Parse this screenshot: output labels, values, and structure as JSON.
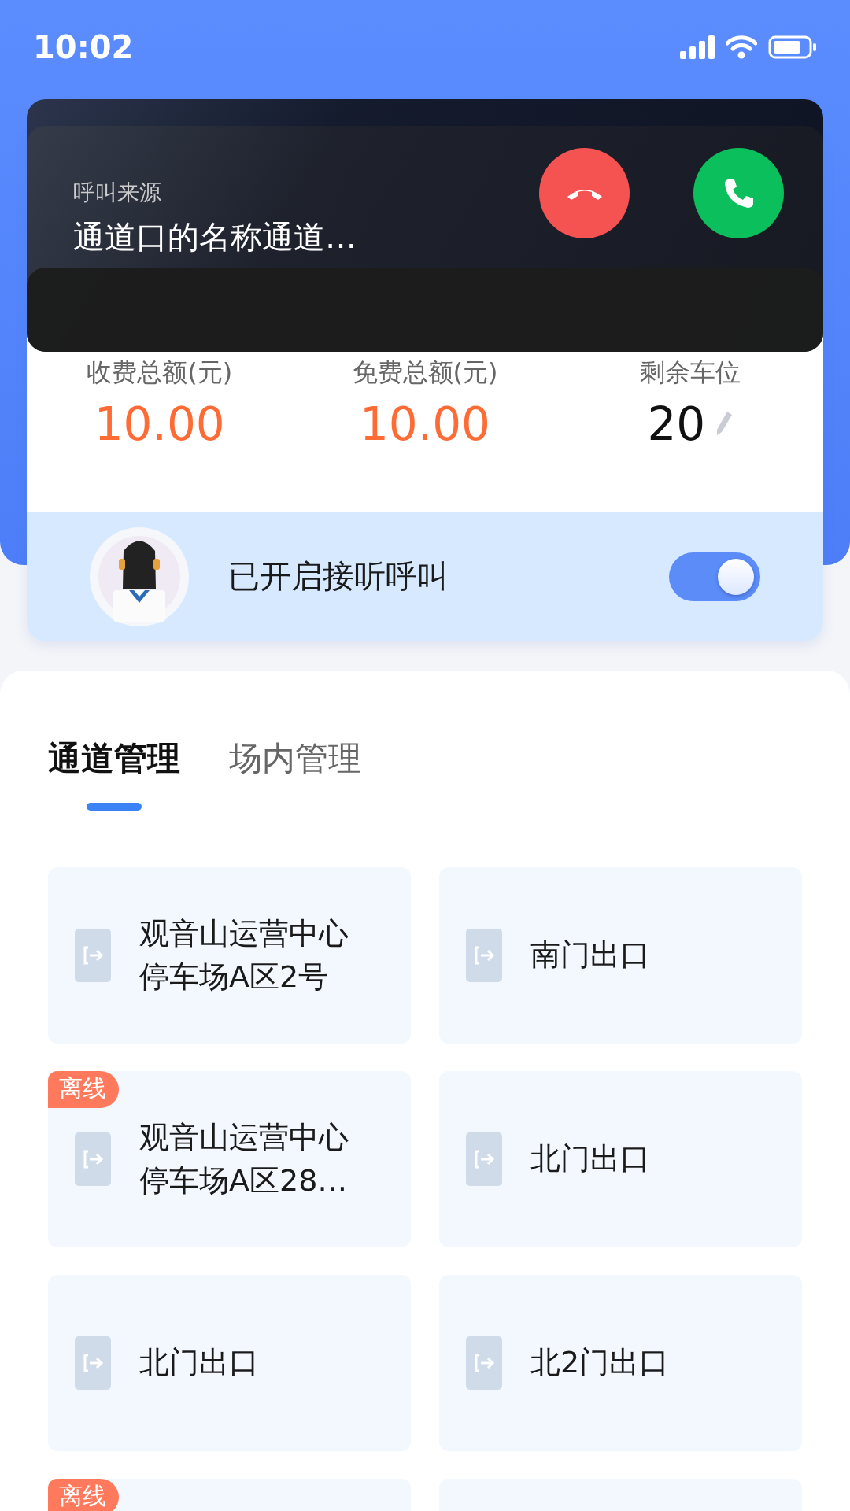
{
  "status_bar": {
    "time": "10:02"
  },
  "stats": [
    {
      "label": "收费总额(元)",
      "value": "10.00",
      "kind": "money"
    },
    {
      "label": "免费总额(元)",
      "value": "10.00",
      "kind": "money"
    },
    {
      "label": "剩余车位",
      "value": "20",
      "kind": "editable"
    }
  ],
  "call_listening": {
    "label": "已开启接听呼叫",
    "on": true
  },
  "incoming_call": {
    "caption": "呼叫来源",
    "source": "通道口的名称通道…"
  },
  "tabs": [
    {
      "label": "通道管理",
      "selected": true
    },
    {
      "label": "场内管理",
      "selected": false
    }
  ],
  "channels": [
    {
      "name": "观音山运营中心停车场A区2号",
      "offline": false
    },
    {
      "name": "南门出口",
      "offline": false
    },
    {
      "name": "观音山运营中心停车场A区28…",
      "offline": true,
      "badge": "离线"
    },
    {
      "name": "北门出口",
      "offline": false
    },
    {
      "name": "北门出口",
      "offline": false
    },
    {
      "name": "北2门出口",
      "offline": false
    },
    {
      "offline": true,
      "badge": "离线"
    },
    {
      "offline": false
    }
  ]
}
